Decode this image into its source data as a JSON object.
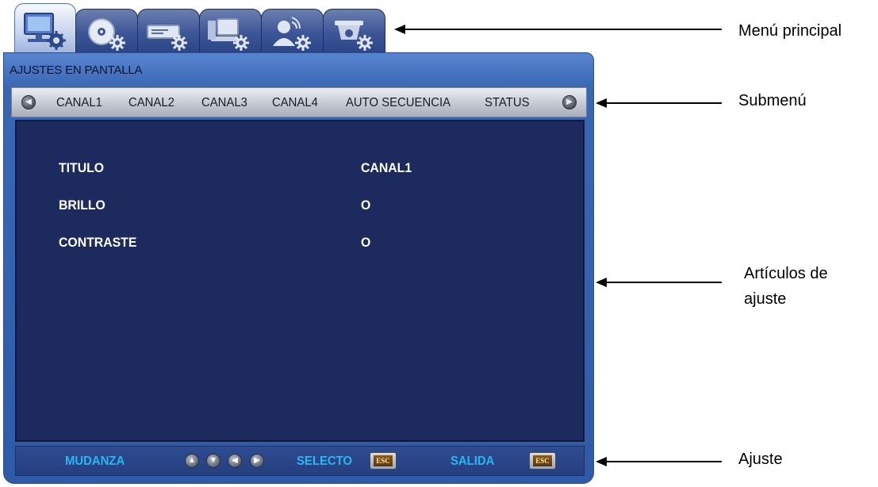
{
  "tabs": [
    {
      "icon": "monitor-settings-icon",
      "active": true
    },
    {
      "icon": "disc-settings-icon",
      "active": false
    },
    {
      "icon": "recorder-settings-icon",
      "active": false
    },
    {
      "icon": "computer-settings-icon",
      "active": false
    },
    {
      "icon": "user-network-settings-icon",
      "active": false
    },
    {
      "icon": "camera-settings-icon",
      "active": false
    }
  ],
  "panel": {
    "title": "AJUSTES EN PANTALLA"
  },
  "submenu": {
    "items": [
      "CANAL1",
      "CANAL2",
      "CANAL3",
      "CANAL4",
      "AUTO SECUENCIA",
      "STATUS"
    ]
  },
  "settings": {
    "rows": [
      {
        "label": "TITULO",
        "value": "CANAL1"
      },
      {
        "label": "BRILLO",
        "value": "O"
      },
      {
        "label": "CONTRASTE",
        "value": "O"
      }
    ]
  },
  "footer": {
    "move_label": "MUDANZA",
    "select_label": "SELECTO",
    "exit_label": "SALIDA",
    "esc_label": "ESC"
  },
  "annotations": {
    "main_menu": "Menú principal",
    "submenu": "Submenú",
    "items_line1": "Artículos de",
    "items_line2": "ajuste",
    "adjust": "Ajuste"
  },
  "colors": {
    "panel_blue": "#2f5aa7",
    "content_navy": "#1c2a5e",
    "footer_text": "#27b7f2"
  }
}
